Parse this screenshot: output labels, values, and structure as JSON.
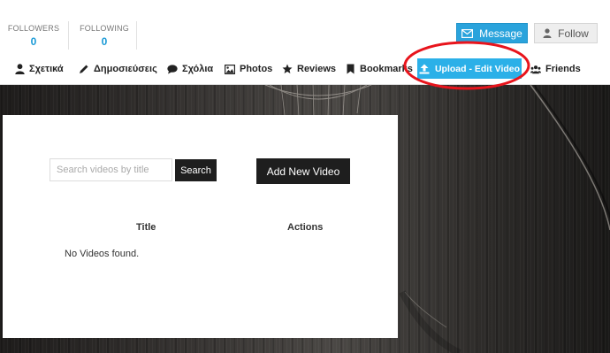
{
  "stats": {
    "followers": {
      "label": "FOLLOWERS",
      "value": "0"
    },
    "following": {
      "label": "FOLLOWING",
      "value": "0"
    }
  },
  "actions": {
    "message_label": "Message",
    "follow_label": "Follow"
  },
  "tabs": [
    {
      "label": "Σχετικά",
      "icon": "user-icon"
    },
    {
      "label": "Δημοσιεύσεις",
      "icon": "pencil-icon"
    },
    {
      "label": "Σχόλια",
      "icon": "comment-icon"
    },
    {
      "label": "Photos",
      "icon": "image-icon"
    },
    {
      "label": "Reviews",
      "icon": "star-icon"
    },
    {
      "label": "Bookmarks",
      "icon": "bookmark-icon"
    },
    {
      "label": "Upload - Edit Video",
      "icon": "upload-icon",
      "active": true
    },
    {
      "label": "Friends",
      "icon": "users-icon"
    }
  ],
  "videos": {
    "search_placeholder": "Search videos by title",
    "search_label": "Search",
    "add_label": "Add New Video",
    "columns": [
      "Title",
      "Actions"
    ],
    "empty_message": "No Videos found."
  },
  "colors": {
    "accent": "#2aa3dc",
    "active_tab": "#2bb0e8",
    "annotation": "#e8141c",
    "dark_button": "#1e1e1e"
  }
}
